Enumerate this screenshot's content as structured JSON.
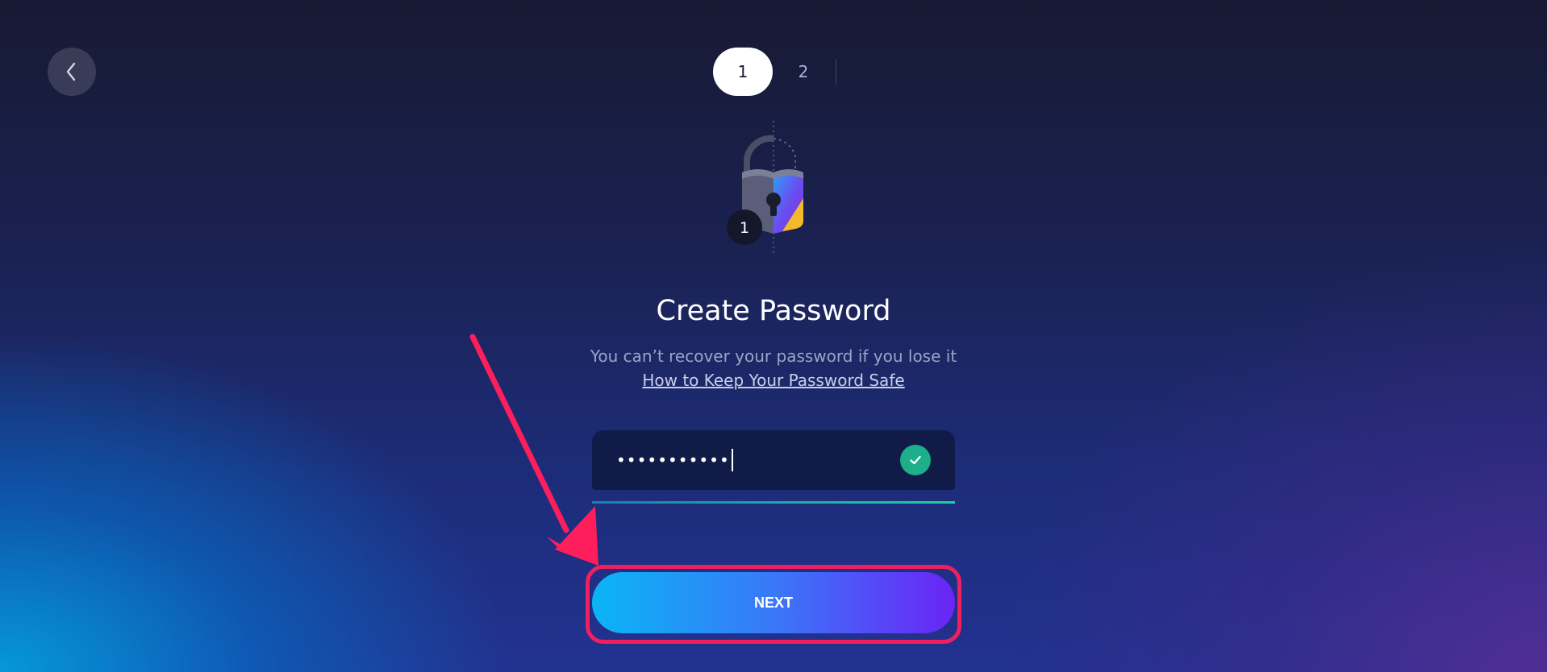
{
  "nav": {
    "back_icon": "chevron-left-icon"
  },
  "stepper": {
    "steps": [
      {
        "label": "1",
        "active": true
      },
      {
        "label": "2",
        "active": false
      }
    ]
  },
  "illustration": {
    "icon": "padlock-icon",
    "badge": "1"
  },
  "main": {
    "title": "Create Password",
    "subtitle": "You can’t recover your password if you lose it",
    "link": "How to Keep Your Password Safe"
  },
  "password_field": {
    "value": "•••••••••••",
    "valid_icon": "checkmark-icon"
  },
  "next_button": {
    "label": "NEXT"
  },
  "colors": {
    "accent_start": "#0ab5f5",
    "accent_end": "#6a24f5",
    "success": "#1dae8a",
    "highlight": "#f0205f"
  }
}
